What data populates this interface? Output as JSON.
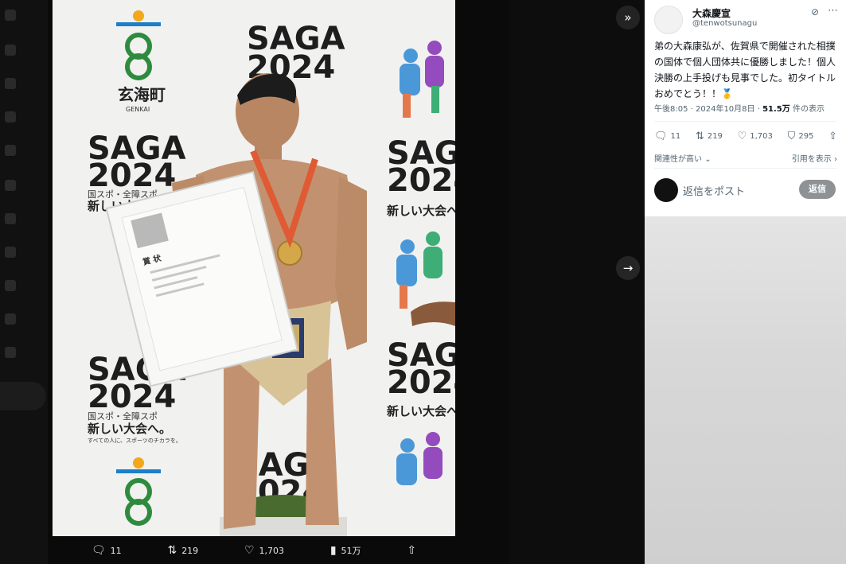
{
  "media": {
    "actions": {
      "replies": "11",
      "reposts": "219",
      "likes": "1,703",
      "views": "51万"
    },
    "photo_text": {
      "saga": "SAGA",
      "year": "2024",
      "town_name": "玄海町",
      "town_roman": "GENKAI",
      "sub1": "国スポ・全障スポ",
      "sub2": "新しい大会へ。",
      "sub3": "すべての人に、スポーツのチカラを。",
      "certificate_title": "賞 状"
    }
  },
  "post": {
    "display_name": "大森慶宣",
    "handle": "@tenwotsunagu",
    "text": "弟の大森康弘が、佐賀県で開催された相撲の国体で個人団体共に優勝しました！個人決勝の上手投げも見事でした。初タイトルおめでとう！！🥇",
    "time": "午後8:05 · 2024年10月8日 · ",
    "views_count": "51.5万",
    "views_label": " 件の表示",
    "stats": {
      "replies": "11",
      "reposts": "219",
      "likes": "1,703",
      "bookmarks": "295"
    },
    "sort_label": "関連性が高い",
    "quotes_label": "引用を表示",
    "reply_placeholder": "返信をポスト",
    "reply_button": "返信"
  },
  "icons": {
    "expand": "chevron-double-right-icon",
    "next": "arrow-right-icon",
    "reply": "speech-bubble-icon",
    "repost": "repost-icon",
    "like": "heart-icon",
    "views": "bar-chart-icon",
    "share": "share-icon",
    "bookmark": "bookmark-icon",
    "grok": "grok-icon",
    "more": "more-icon"
  },
  "colors": {
    "panel_bg": "#ffffff",
    "text_primary": "#0f1419",
    "text_secondary": "#536471",
    "reply_button_bg": "#8e9295"
  }
}
